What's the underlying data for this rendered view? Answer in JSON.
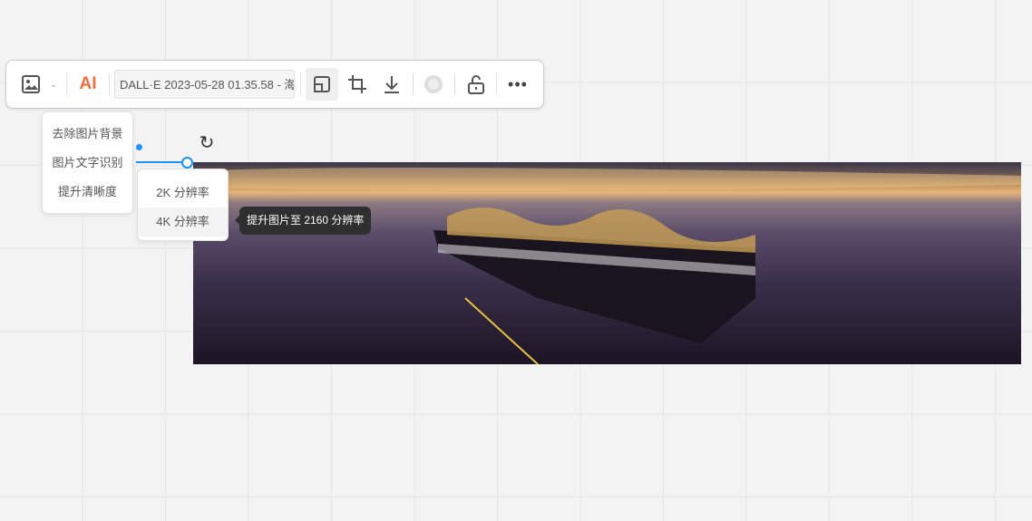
{
  "toolbar": {
    "ai_label": "AI",
    "file_name": "DALL·E 2023-05-28 01.35.58 - 海",
    "accent": "#f26b3a"
  },
  "ai_menu": {
    "items": [
      "去除图片背景",
      "图片文字识别",
      "提升清晰度"
    ]
  },
  "resolution_menu": {
    "items": [
      "2K 分辨率",
      "4K 分辨率"
    ]
  },
  "tooltip": "提升图片至 2160 分辨率"
}
